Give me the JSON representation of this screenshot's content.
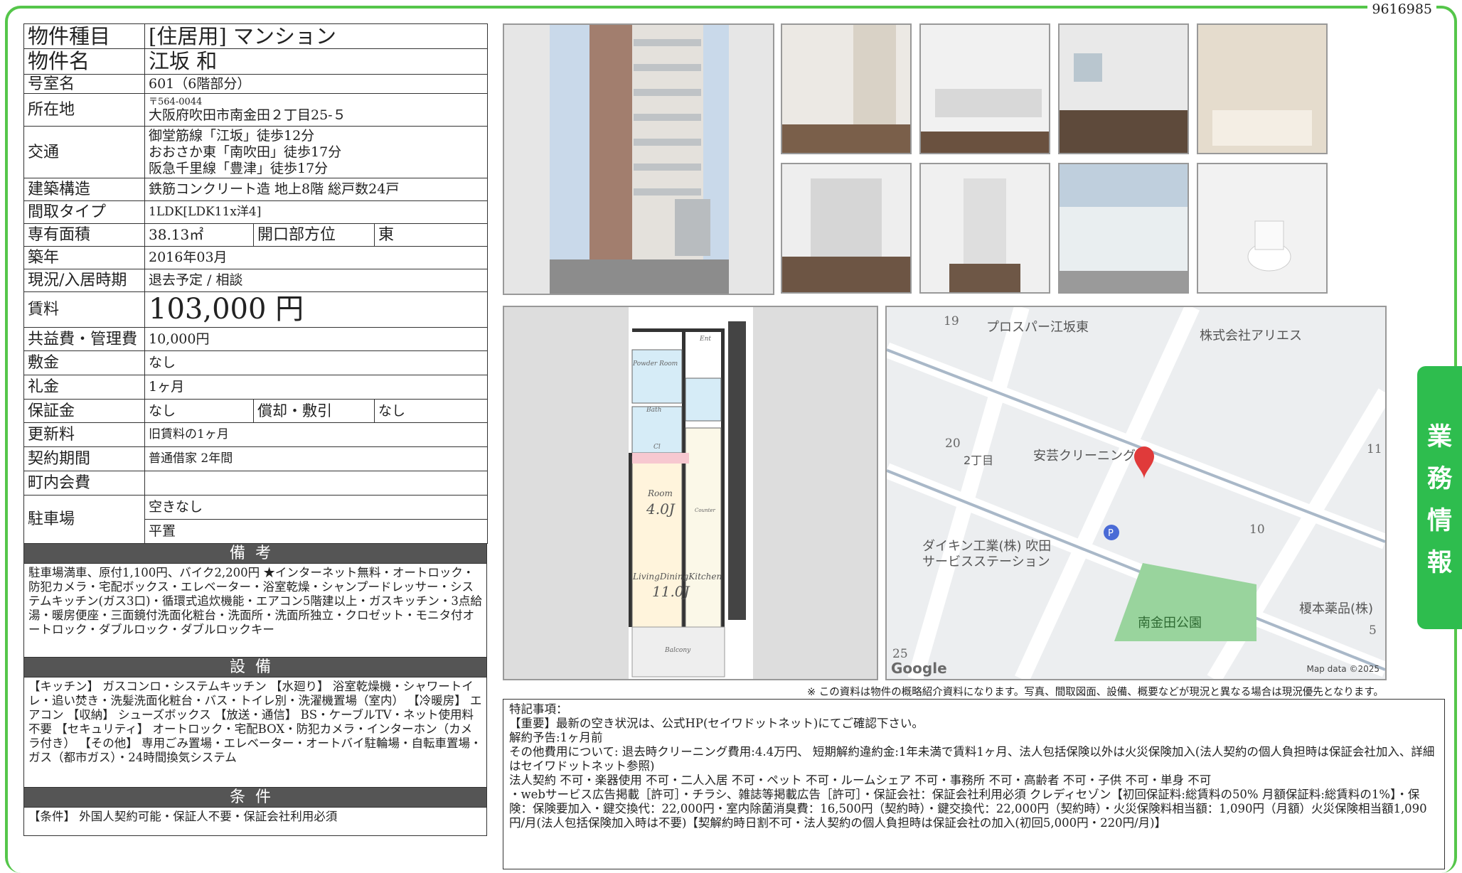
{
  "doc_id": "9616985",
  "info": {
    "type_label": "物件種目",
    "type_value": "[住居用] マンション",
    "name_label": "物件名",
    "name_value": "江坂 和",
    "room_label": "号室名",
    "room_value": "601（6階部分）",
    "addr_label": "所在地",
    "postal": "〒564-0044",
    "addr_value": "大阪府吹田市南金田２丁目25-５",
    "transit_label": "交通",
    "transit": [
      "御堂筋線「江坂」徒歩12分",
      "おおさか東「南吹田」徒歩17分",
      "阪急千里線「豊津」徒歩17分"
    ],
    "struct_label": "建築構造",
    "struct_value": "鉄筋コンクリート造 地上8階 総戸数24戸",
    "layout_label": "間取タイプ",
    "layout_value": "1LDK[LDK11x洋4]",
    "area_label": "専有面積",
    "area_value": "38.13㎡",
    "dir_label": "開口部方位",
    "dir_value": "東",
    "built_label": "築年",
    "built_value": "2016年03月",
    "status_label": "現況/入居時期",
    "status_value": "退去予定 / 相談",
    "rent_label": "賃料",
    "rent_value": "103,000 円",
    "fee_label": "共益費・管理費",
    "fee_value": "10,000円",
    "deposit_label": "敷金",
    "deposit_value": "なし",
    "key_label": "礼金",
    "key_value": "1ヶ月",
    "guarantee_label": "保証金",
    "guarantee_value": "なし",
    "amort_label": "償却・敷引",
    "amort_value": "なし",
    "renew_label": "更新料",
    "renew_value": "旧賃料の1ヶ月",
    "contract_label": "契約期間",
    "contract_value": "普通借家 2年間",
    "town_label": "町内会費",
    "town_value": "",
    "parking_label": "駐車場",
    "parking_status": "空きなし",
    "parking_type": "平置"
  },
  "bikou": {
    "header": "備考",
    "text": "駐車場満車、原付1,100円、バイク2,200円 ★インターネット無料・オートロック・防犯カメラ・宅配ボックス・エレベーター・浴室乾燥・シャンプードレッサー・システムキッチン(ガス3口)・循環式追炊機能・エアコン5階建以上・ガスキッチン・3点給湯・暖房便座・三面鏡付洗面化粧台・洗面所・洗面所独立・クロゼット・モニタ付オートロック・ダブルロック・ダブルロックキー"
  },
  "setsubi": {
    "header": "設備",
    "text": "【キッチン】 ガスコンロ・システムキッチン 【水廻り】 浴室乾燥機・シャワートイレ・追い焚き・洗髪洗面化粧台・バス・トイレ別・洗濯機置場（室内） 【冷暖房】 エアコン 【収納】 シューズボックス 【放送・通信】 BS・ケーブルTV・ネット使用料不要 【セキュリティ】 オートロック・宅配BOX・防犯カメラ・インターホン（カメラ付き） 【その他】 専用ごみ置場・エレベーター・オートバイ駐輪場・自転車置場・ガス（都市ガス）・24時間換気システム"
  },
  "jouken": {
    "header": "条件",
    "text": "【条件】 外国人契約可能・保証人不要・保証会社利用必須"
  },
  "floorplan": {
    "powder": "Powder Room",
    "bath": "Bath",
    "cl": "Cl",
    "ent": "Ent",
    "room": "Room",
    "room_size": "4.0J",
    "ldk": "LivingDiningKitchen",
    "ldk_size": "11.0J",
    "balcony": "Balcony",
    "counter": "Counter"
  },
  "map": {
    "labels": [
      "プロスパー江坂東",
      "株式会社アリエス",
      "安芸クリーニング",
      "ダイキン工業(株) 吹田",
      "サービスステーション",
      "榎本薬品(株)",
      "南金田公園",
      "2丁目"
    ],
    "numbers": [
      "19",
      "20",
      "11",
      "10",
      "25",
      "5"
    ],
    "google": "Google",
    "mapdata": "Map data ©2025"
  },
  "disclaimer": "※ この資料は物件の概略紹介資料になります。写真、間取図面、設備、概要などが現況と異なる場合は現況優先となります。",
  "remarks": [
    "特記事項：",
    "【重要】最新の空き状況は、公式HP(セイワドットネット)にてご確認下さい。",
    "解約予告:1ヶ月前",
    "その他費用について: 退去時クリーニング費用:4.4万円、 短期解約違約金:1年未満で賃料1ヶ月、法人包括保険以外は火災保険加入(法人契約の個人負担時は保証会社加入、詳細はセイワドットネット参照)",
    "法人契約 不可・楽器使用 不可・二人入居 不可・ペット 不可・ルームシェア 不可・事務所 不可・高齢者 不可・子供 不可・単身 不可",
    "・webサービス広告掲載［許可］・チラシ、雑誌等掲載広告［許可］・保証会社：保証会社利用必須 クレディセゾン【初回保証料:総賃料の50% 月額保証料:総賃料の1%】・保険：保険要加入・鍵交換代：22,000円・室内除菌消臭費：16,500円（契約時）・鍵交換代：22,000円（契約時）・火災保険料相当額：1,090円（月額）火災保険相当額1,090円/月(法人包括保険加入時は不要)【契解約時日割不可・法人契約の個人負担時は保証会社の加入(初回5,000円・220円/月)】"
  ],
  "sidetab": [
    "業",
    "務",
    "情",
    "報"
  ]
}
